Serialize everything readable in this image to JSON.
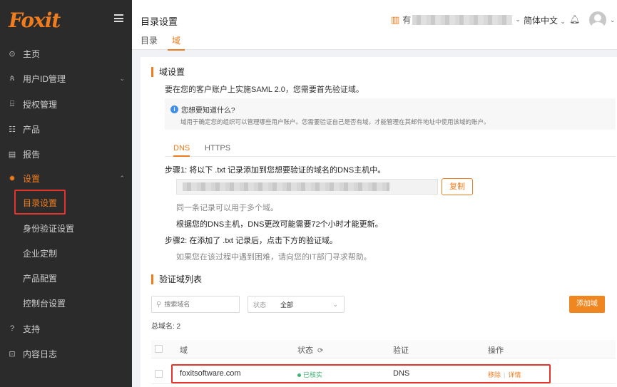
{
  "brand": {
    "logo_text": "Foxit"
  },
  "sidebar": {
    "items": [
      {
        "label": "主页",
        "icon": "home-icon",
        "glyph": "⊙"
      },
      {
        "label": "用户ID管理",
        "icon": "user-icon",
        "glyph": "ጰ",
        "chevron": "⌄"
      },
      {
        "label": "授权管理",
        "icon": "license-icon",
        "glyph": "⌸"
      },
      {
        "label": "产品",
        "icon": "product-icon",
        "glyph": "☷"
      },
      {
        "label": "报告",
        "icon": "report-icon",
        "glyph": "▤"
      },
      {
        "label": "设置",
        "icon": "gear-icon",
        "glyph": "✹",
        "chevron": "⌃"
      }
    ],
    "settings_sub": [
      "目录设置",
      "身份验证设置",
      "企业定制",
      "产品配置",
      "控制台设置"
    ],
    "bottom_items": [
      {
        "label": "支持",
        "icon": "help-icon",
        "glyph": "?"
      },
      {
        "label": "内容日志",
        "icon": "log-icon",
        "glyph": "⊡"
      }
    ]
  },
  "header": {
    "title": "目录设置",
    "tabs": [
      "目录",
      "域"
    ],
    "org_initial": "有",
    "language": "简体中文",
    "language_chevron": "⌄",
    "bell_glyph": "🔔︎",
    "avatar_chevron": "⌄"
  },
  "domain_settings": {
    "title": "域设置",
    "description": "要在您的客户账户上实施SAML 2.0，您需要首先验证域。",
    "info_question": "您想要知道什么?",
    "info_detail": "域用于确定您的组织可以管理哪些用户账户。您需要验证自己是否有域，才能管理在其邮件地址中使用该域的账户。",
    "method_tabs": [
      "DNS",
      "HTTPS"
    ],
    "step1": "步骤1: 将以下 .txt 记录添加到您想要验证的域名的DNS主机中。",
    "copy_label": "复制",
    "note_multi": "同一条记录可以用于多个域。",
    "note_dns": "根据您的DNS主机，DNS更改可能需要72个小时才能更新。",
    "step2": "步骤2: 在添加了 .txt 记录后，点击下方的验证域。",
    "note_help": "如果您在该过程中遇到困难，请向您的IT部门寻求帮助。"
  },
  "verified_list": {
    "title": "验证域列表",
    "search_placeholder": "搜索域名",
    "status_label": "状态",
    "status_value": "全部",
    "add_button": "添加域",
    "total": "总域名: 2",
    "columns": [
      "域",
      "状态",
      "验证",
      "操作"
    ],
    "rows": [
      {
        "domain": "foxitsoftware.com",
        "status": "已核实",
        "verification": "DNS",
        "remove": "移除",
        "details": "详情"
      }
    ]
  },
  "colors": {
    "accent": "#f07c1d",
    "sidebar_bg": "#2b2b2b",
    "highlight": "#e5342b",
    "verified": "#3cb371"
  }
}
